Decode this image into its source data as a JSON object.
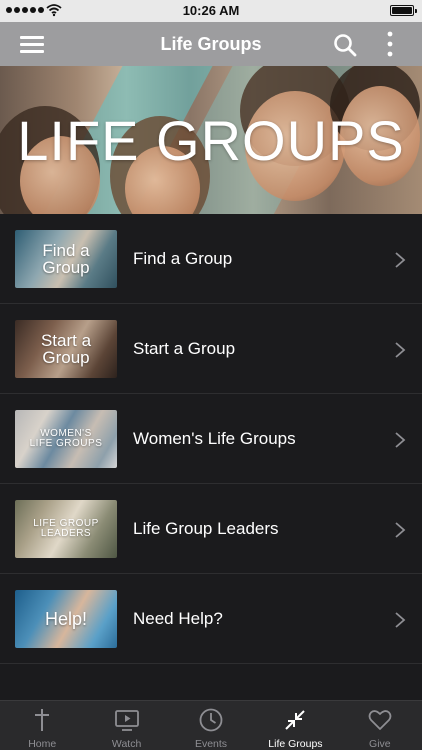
{
  "status_bar": {
    "time": "10:26 AM"
  },
  "nav": {
    "title": "Life Groups"
  },
  "hero": {
    "text": "LIFE GROUPS"
  },
  "list": [
    {
      "label": "Find a Group",
      "thumb_text_1": "Find a",
      "thumb_text_2": "Group"
    },
    {
      "label": "Start a Group",
      "thumb_text_1": "Start a",
      "thumb_text_2": "Group"
    },
    {
      "label": "Women's Life Groups",
      "thumb_text_1": "WOMEN'S",
      "thumb_text_2": "LIFE GROUPS"
    },
    {
      "label": "Life Group Leaders",
      "thumb_text_1": "LIFE GROUP",
      "thumb_text_2": "LEADERS"
    },
    {
      "label": "Need Help?",
      "thumb_text_1": "Help!",
      "thumb_text_2": ""
    }
  ],
  "tabs": [
    {
      "label": "Home",
      "icon": "cross-icon",
      "active": false
    },
    {
      "label": "Watch",
      "icon": "play-screen-icon",
      "active": false
    },
    {
      "label": "Events",
      "icon": "clock-icon",
      "active": false
    },
    {
      "label": "Life Groups",
      "icon": "collapse-arrows-icon",
      "active": true
    },
    {
      "label": "Give",
      "icon": "heart-icon",
      "active": false
    }
  ],
  "colors": {
    "nav_bar": "#9d9d9f",
    "background": "#1b1b1d",
    "tab_bar": "#2a2a2c",
    "tab_inactive": "#8e8e93",
    "tab_active": "#ffffff"
  }
}
